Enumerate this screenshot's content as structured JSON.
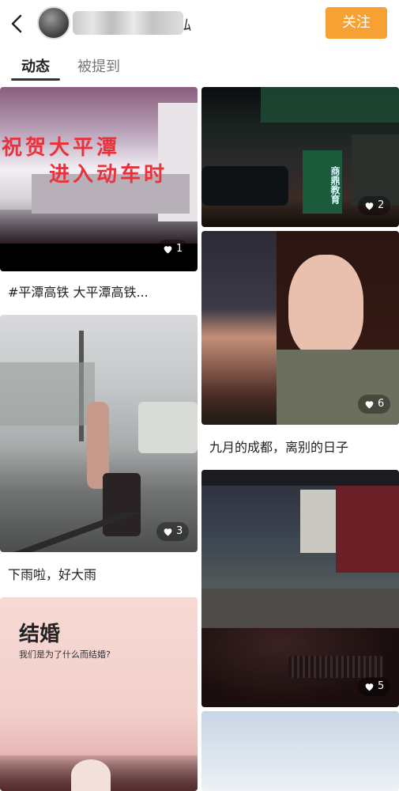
{
  "header": {
    "back_icon": "back-arrow-icon",
    "name_visible_tail": "ﾑ",
    "follow_label": "关注",
    "accent": "#f7a134"
  },
  "tabs": [
    {
      "label": "动态",
      "active": true
    },
    {
      "label": "被提到",
      "active": false
    }
  ],
  "feed": {
    "left": [
      {
        "overlay_lines": [
          "祝贺大平潭",
          "进入动车时"
        ],
        "likes": "1",
        "caption": "#平潭高铁 大平潭高铁..."
      },
      {
        "likes": "3",
        "caption": "下雨啦，好大雨"
      },
      {
        "overlay_title": "结婚",
        "overlay_sub": "我们是为了什么而结婚?"
      }
    ],
    "right": [
      {
        "sign_text": "商鼎教育",
        "likes": "2"
      },
      {
        "likes": "6",
        "caption": "九月的成都，离别的日子"
      },
      {
        "likes": "5"
      },
      {}
    ]
  }
}
